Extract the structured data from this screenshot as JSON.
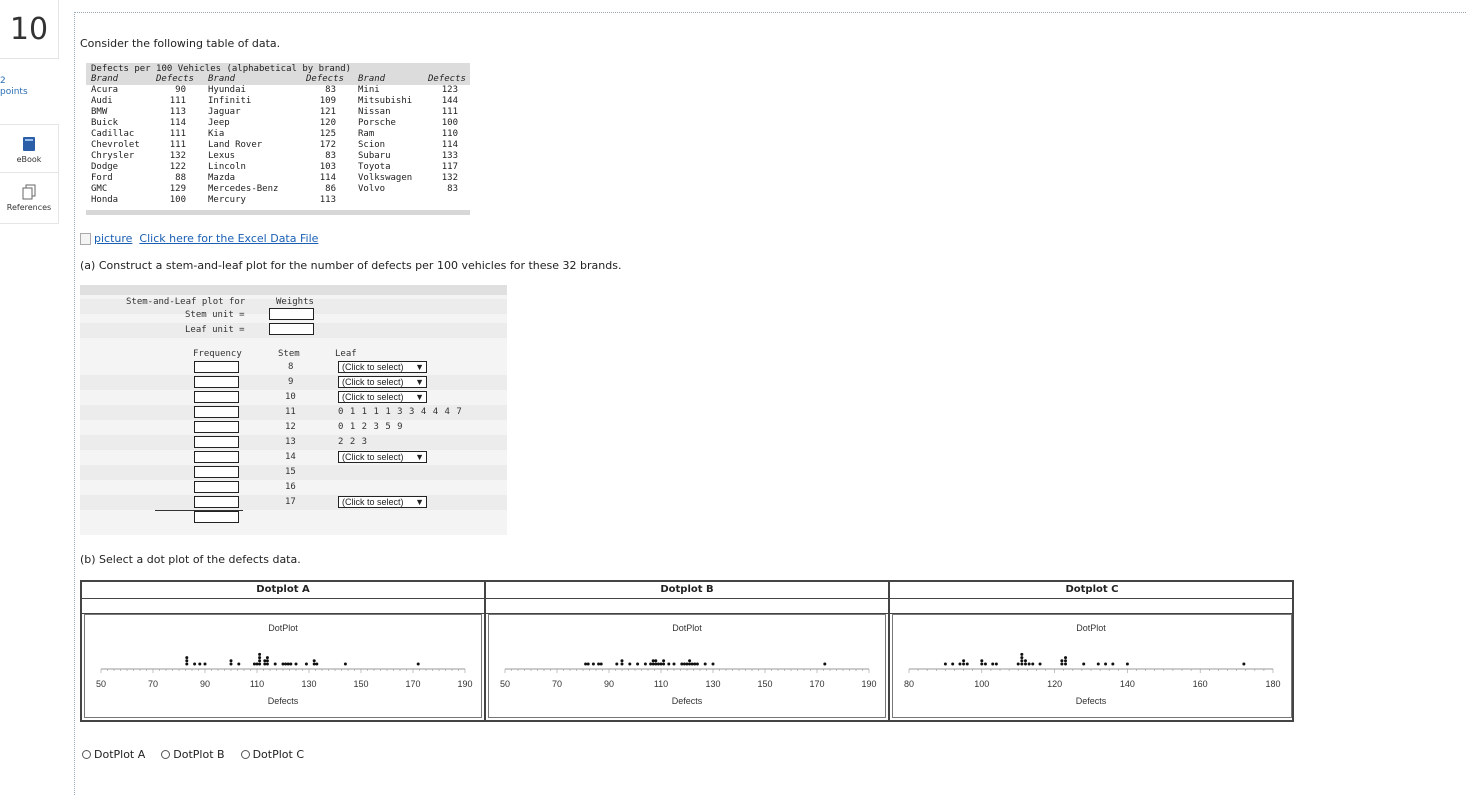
{
  "question": {
    "number": "10",
    "points": "2\npoints"
  },
  "rail": {
    "ebook": "eBook",
    "references": "References"
  },
  "intro": "Consider the following table of data.",
  "data_table": {
    "title": "Defects per 100 Vehicles (alphabetical by brand)",
    "headers": [
      "Brand",
      "Defects",
      "Brand",
      "Defects",
      "Brand",
      "Defects"
    ],
    "col1": [
      [
        "Acura",
        "90"
      ],
      [
        "Audi",
        "111"
      ],
      [
        "BMW",
        "113"
      ],
      [
        "Buick",
        "114"
      ],
      [
        "Cadillac",
        "111"
      ],
      [
        "Chevrolet",
        "111"
      ],
      [
        "Chrysler",
        "132"
      ],
      [
        "Dodge",
        "122"
      ],
      [
        "Ford",
        "88"
      ],
      [
        "GMC",
        "129"
      ],
      [
        "Honda",
        "100"
      ]
    ],
    "col2": [
      [
        "Hyundai",
        "83"
      ],
      [
        "Infiniti",
        "109"
      ],
      [
        "Jaguar",
        "121"
      ],
      [
        "Jeep",
        "120"
      ],
      [
        "Kia",
        "125"
      ],
      [
        "Land Rover",
        "172"
      ],
      [
        "Lexus",
        "83"
      ],
      [
        "Lincoln",
        "103"
      ],
      [
        "Mazda",
        "114"
      ],
      [
        "Mercedes-Benz",
        "86"
      ],
      [
        "Mercury",
        "113"
      ]
    ],
    "col3": [
      [
        "Mini",
        "123"
      ],
      [
        "Mitsubishi",
        "144"
      ],
      [
        "Nissan",
        "111"
      ],
      [
        "Porsche",
        "100"
      ],
      [
        "Ram",
        "110"
      ],
      [
        "Scion",
        "114"
      ],
      [
        "Subaru",
        "133"
      ],
      [
        "Toyota",
        "117"
      ],
      [
        "Volkswagen",
        "132"
      ],
      [
        "Volvo",
        "83"
      ]
    ]
  },
  "excel_link": {
    "alt": "picture",
    "text": "Click here for the Excel Data File"
  },
  "part_a": "(a) Construct a stem-and-leaf plot for the number of defects per 100 vehicles for these 32 brands.",
  "stem_leaf": {
    "title": "Stem-and-Leaf plot for",
    "title_value": "Weights",
    "stem_unit_label": "Stem unit =",
    "leaf_unit_label": "Leaf unit =",
    "col_frequency": "Frequency",
    "col_stem": "Stem",
    "col_leaf": "Leaf",
    "select_label": "(Click to select)",
    "rows": [
      {
        "stem": "8",
        "leaf": null
      },
      {
        "stem": "9",
        "leaf": null
      },
      {
        "stem": "10",
        "leaf": null
      },
      {
        "stem": "11",
        "leaf": "0 1 1 1 1 3 3 4 4 4 7"
      },
      {
        "stem": "12",
        "leaf": "0 1 2 3 5 9"
      },
      {
        "stem": "13",
        "leaf": "2 2 3"
      },
      {
        "stem": "14",
        "leaf": null
      },
      {
        "stem": "15",
        "leaf": ""
      },
      {
        "stem": "16",
        "leaf": ""
      },
      {
        "stem": "17",
        "leaf": null
      }
    ]
  },
  "part_b": "(b) Select a dot plot of the defects data.",
  "dotplots": [
    {
      "name": "Dotplot A",
      "title": "DotPlot",
      "xlabel": "Defects",
      "ticks": [
        "50",
        "70",
        "90",
        "110",
        "130",
        "150",
        "170",
        "190"
      ],
      "range": [
        50,
        190
      ],
      "values": [
        83,
        83,
        83,
        86,
        88,
        90,
        100,
        100,
        103,
        109,
        110,
        111,
        111,
        111,
        111,
        113,
        113,
        114,
        114,
        114,
        117,
        120,
        121,
        122,
        123,
        125,
        129,
        132,
        132,
        133,
        144,
        172
      ]
    },
    {
      "name": "Dotplot B",
      "title": "DotPlot",
      "xlabel": "Defects",
      "ticks": [
        "50",
        "70",
        "90",
        "110",
        "130",
        "150",
        "170",
        "190"
      ],
      "range": [
        50,
        190
      ],
      "values": [
        81,
        82,
        84,
        86,
        87,
        93,
        95,
        95,
        98,
        101,
        104,
        106,
        107,
        107,
        108,
        108,
        109,
        110,
        111,
        111,
        113,
        115,
        118,
        119,
        120,
        121,
        121,
        122,
        123,
        124,
        127,
        130,
        173
      ]
    },
    {
      "name": "Dotplot C",
      "title": "DotPlot",
      "xlabel": "Defects",
      "ticks": [
        "80",
        "100",
        "120",
        "140",
        "160",
        "180"
      ],
      "range": [
        80,
        180
      ],
      "values": [
        90,
        92,
        94,
        95,
        95,
        96,
        100,
        100,
        101,
        103,
        104,
        110,
        111,
        111,
        111,
        111,
        112,
        112,
        113,
        114,
        116,
        122,
        122,
        123,
        123,
        123,
        128,
        132,
        134,
        136,
        140,
        172
      ]
    }
  ],
  "choices": [
    "DotPlot A",
    "DotPlot B",
    "DotPlot C"
  ]
}
